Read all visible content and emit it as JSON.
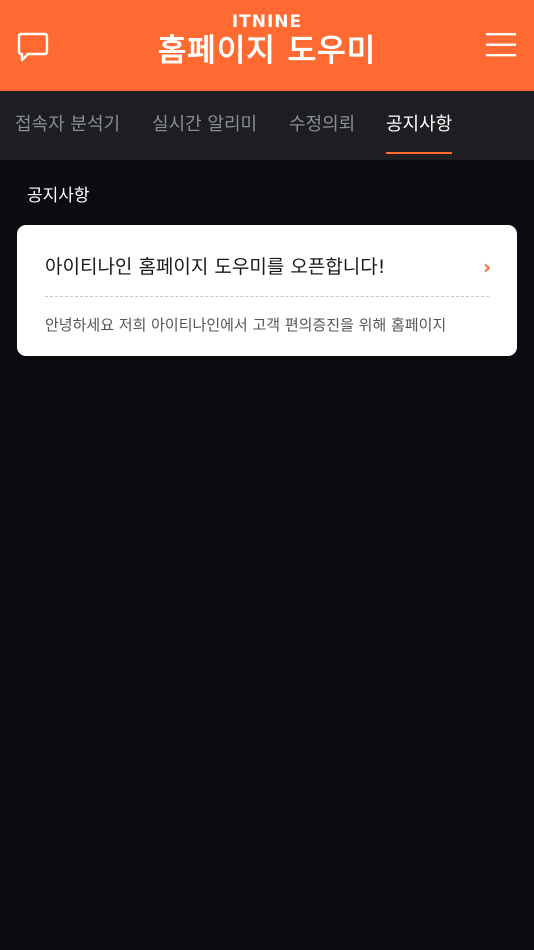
{
  "header": {
    "logo_small": "ITNINE",
    "logo_main": "홈페이지 도우미",
    "chat_icon": "chat-bubble-icon",
    "menu_icon": "hamburger-menu-icon",
    "background_color": "#fe6a31"
  },
  "tabs": [
    {
      "label": "접속자 분석기",
      "active": false
    },
    {
      "label": "실시간 알리미",
      "active": false
    },
    {
      "label": "수정의뢰",
      "active": false
    },
    {
      "label": "공지사항",
      "active": true
    }
  ],
  "accent_color": "#fe6a31",
  "section": {
    "title": "공지사항"
  },
  "notices": [
    {
      "title": "아이티나인 홈페이지 도우미를 오픈합니다!",
      "preview": "안녕하세요 저희 아이티나인에서 고객 편의증진을 위해 홈페이지",
      "chevron": "›"
    }
  ]
}
